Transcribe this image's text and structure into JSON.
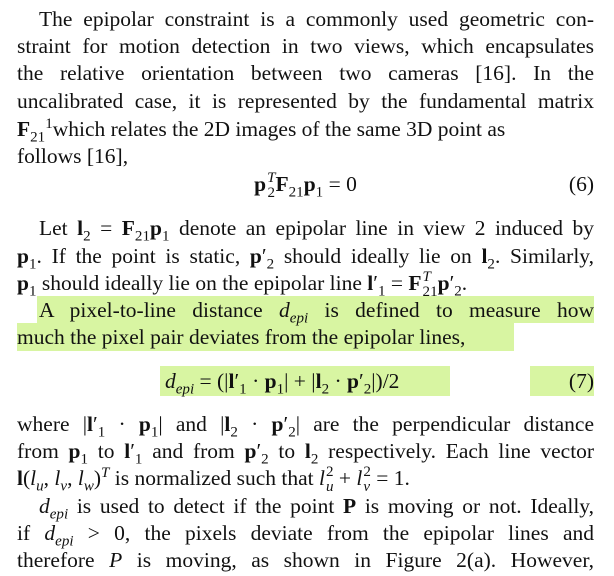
{
  "paragraphs": {
    "p1": [
      "The epipolar constraint is a commonly used geometric con-",
      "straint for motion detection in two views, which encapsulates",
      "the relative orientation between two cameras [16]. In the",
      "uncalibrated case, it is represented by the fundamental matrix",
      "which relates the 2D images of the same 3D point as",
      "follows [16],"
    ],
    "p2": [
      "Let",
      "denote an epipolar line in view 2 induced by",
      ". If the point is static,",
      "should ideally lie on",
      ". Similarly,",
      "should ideally lie on the epipolar line"
    ],
    "p3": [
      "A pixel-to-line distance",
      "is defined to measure how",
      "much the pixel pair deviates from the epipolar lines,"
    ],
    "p4": [
      "where",
      "and",
      "are the perpendicular distance",
      "from",
      "to",
      "and from",
      "to",
      "respectively. Each line vector",
      "is normalized such that"
    ],
    "p5": [
      "is used to detect if the point",
      "is moving or not. Ideally,",
      "if",
      ", the pixels deviate from the epipolar lines and",
      "therefore",
      "is moving, as shown in Figure 2(a). However,"
    ]
  },
  "equations": {
    "eq6_number": "(6)",
    "eq7_number": "(7)"
  },
  "highlight_color": "#d8f5a2"
}
